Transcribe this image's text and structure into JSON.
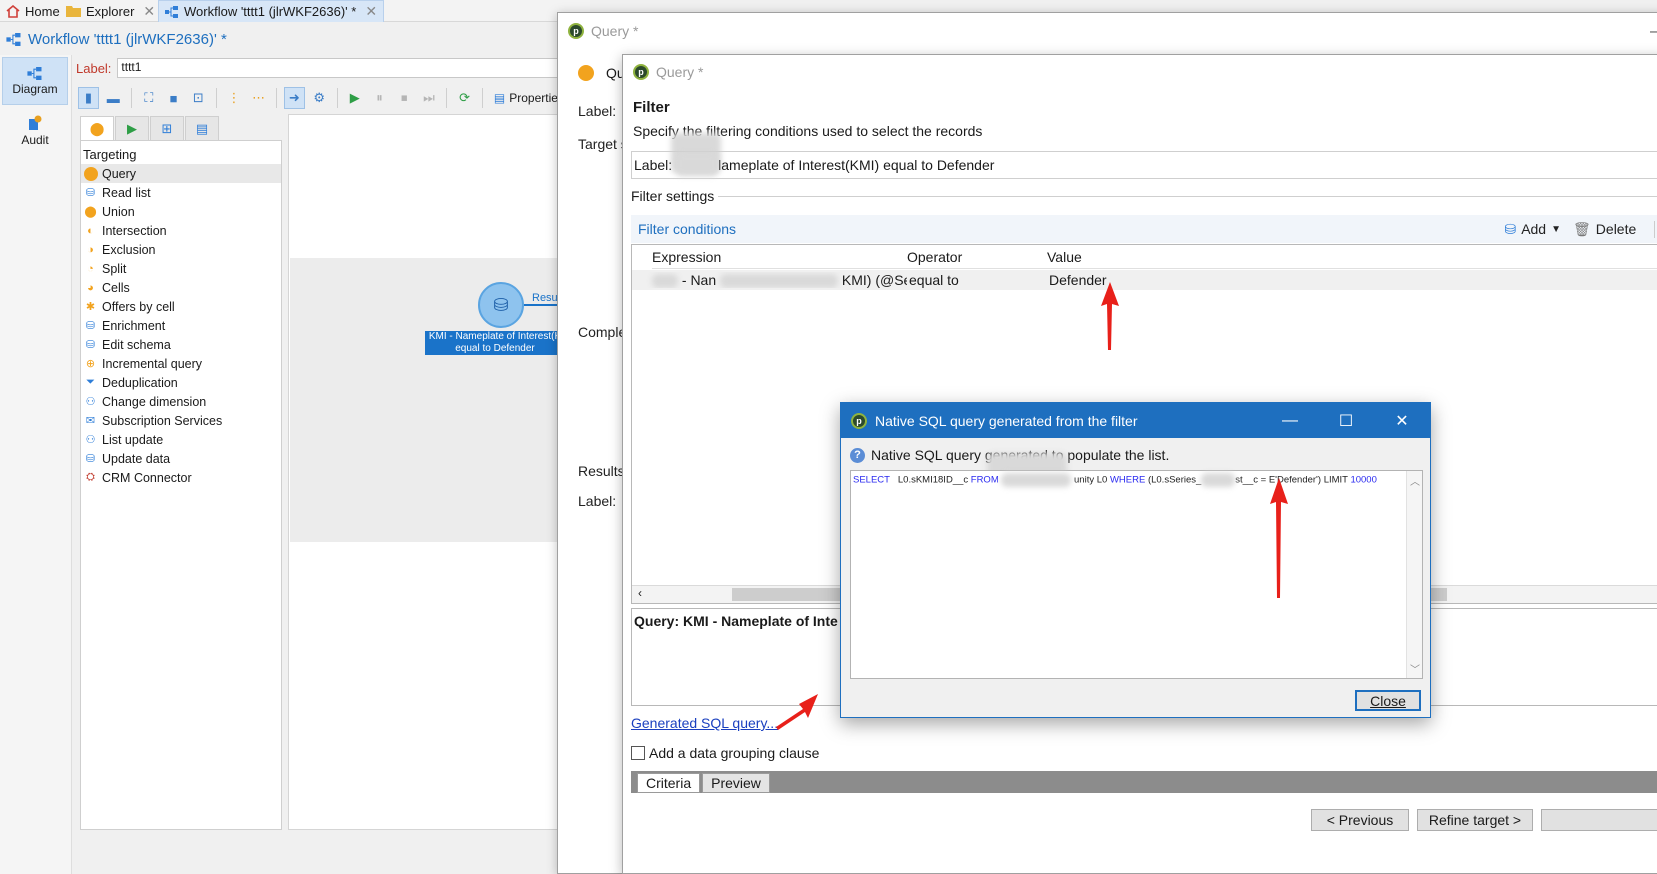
{
  "tabs": [
    {
      "label": "Home"
    },
    {
      "label": "Explorer"
    },
    {
      "label": "Workflow 'tttt1 (jlrWKF2636)' *"
    }
  ],
  "workflow": {
    "title": "Workflow 'tttt1 (jlrWKF2636)' *",
    "label_caption": "Label:",
    "label_value": "tttt1",
    "properties": "Properties"
  },
  "leftnav": {
    "diagram": "Diagram",
    "audit": "Audit"
  },
  "palette": {
    "heading": "Targeting",
    "items": [
      {
        "label": "Query",
        "icon": "query-icon"
      },
      {
        "label": "Read list",
        "icon": "read-list-icon"
      },
      {
        "label": "Union",
        "icon": "union-icon"
      },
      {
        "label": "Intersection",
        "icon": "intersection-icon"
      },
      {
        "label": "Exclusion",
        "icon": "exclusion-icon"
      },
      {
        "label": "Split",
        "icon": "split-icon"
      },
      {
        "label": "Cells",
        "icon": "cells-icon"
      },
      {
        "label": "Offers by cell",
        "icon": "offers-icon"
      },
      {
        "label": "Enrichment",
        "icon": "enrichment-icon"
      },
      {
        "label": "Edit schema",
        "icon": "schema-icon"
      },
      {
        "label": "Incremental query",
        "icon": "incremental-icon"
      },
      {
        "label": "Deduplication",
        "icon": "dedup-icon"
      },
      {
        "label": "Change dimension",
        "icon": "dimension-icon"
      },
      {
        "label": "Subscription Services",
        "icon": "subscription-icon"
      },
      {
        "label": "List update",
        "icon": "list-update-icon"
      },
      {
        "label": "Update data",
        "icon": "update-data-icon"
      },
      {
        "label": "CRM Connector",
        "icon": "crm-icon"
      }
    ]
  },
  "canvas": {
    "node_label": "KMI - Nameplate of Interest(K\nequal to Defender",
    "result": "Resu"
  },
  "query1": {
    "title": "Query *",
    "label": "Label:",
    "target": "Target s",
    "complement": "Comple",
    "results": "Results",
    "results_label": "Label:",
    "qu": "Qu"
  },
  "query2": {
    "title": "Query *",
    "heading": "Filter",
    "description": "Specify the filtering conditions used to select the records",
    "label_caption": "Label:",
    "label_value": "lameplate of Interest(KMI) equal to Defender",
    "filter_settings": "Filter settings",
    "filter_conditions": "Filter conditions",
    "add": "Add",
    "delete": "Delete",
    "columns": {
      "expression": "Expression",
      "operator": "Operator",
      "value": "Value"
    },
    "row": {
      "expression": "- Nan",
      "expression_tail": "KMI) (@Ser",
      "operator": "equal to",
      "value": "Defender"
    },
    "summary": "Query: KMI - Nameplate of Inte",
    "generated_sql": "Generated SQL query...",
    "grouping": "Add a data grouping clause",
    "tab_criteria": "Criteria",
    "tab_preview": "Preview",
    "previous": "< Previous",
    "refine": "Refine target >"
  },
  "sql_dialog": {
    "title": "Native SQL query generated from the filter",
    "info": "Native SQL query generated to populate the list.",
    "sql": {
      "select": "SELECT",
      "col": "L0.sKMI18ID__c",
      "from": "FROM",
      "table": "unity L0",
      "where": "WHERE",
      "cond_a": "(L0.sSeries_",
      "cond_b": "st__c = E'Defender')",
      "limit": "LIMIT",
      "limit_val": "10000"
    },
    "close": "Close"
  }
}
